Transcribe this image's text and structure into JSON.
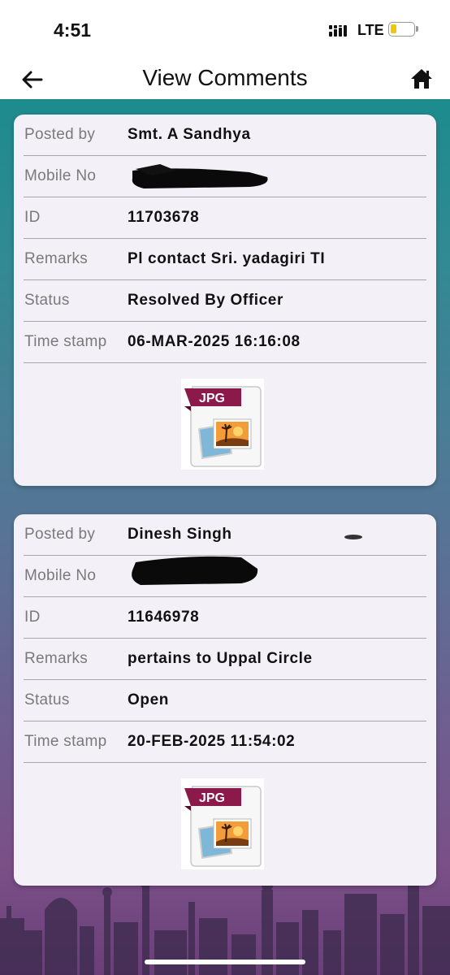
{
  "status_bar": {
    "time": "4:51",
    "network": "LTE"
  },
  "header": {
    "title": "View Comments",
    "back_icon": "arrow-left-icon",
    "home_icon": "home-icon"
  },
  "labels": {
    "posted_by": "Posted by",
    "mobile_no": "Mobile No",
    "id": "ID",
    "remarks": "Remarks",
    "status": "Status",
    "time_stamp": "Time stamp"
  },
  "comments": [
    {
      "posted_by": "Smt. A Sandhya",
      "mobile_no": "",
      "id": "11703678",
      "remarks": "Pl contact Sri. yadagiri TI",
      "status": "Resolved By Officer",
      "time_stamp": "06-MAR-2025 16:16:08",
      "attachment_badge": "JPG"
    },
    {
      "posted_by": "Dinesh Singh",
      "mobile_no": "",
      "id": "11646978",
      "remarks": "pertains to Uppal Circle",
      "status": "Open",
      "time_stamp": "20-FEB-2025 11:54:02",
      "attachment_badge": "JPG"
    }
  ],
  "colors": {
    "accent_teal": "#1d8b8e",
    "accent_purple": "#7a4f87",
    "card_bg": "#f3f0f8",
    "jpg_badge": "#8b1a4a"
  }
}
